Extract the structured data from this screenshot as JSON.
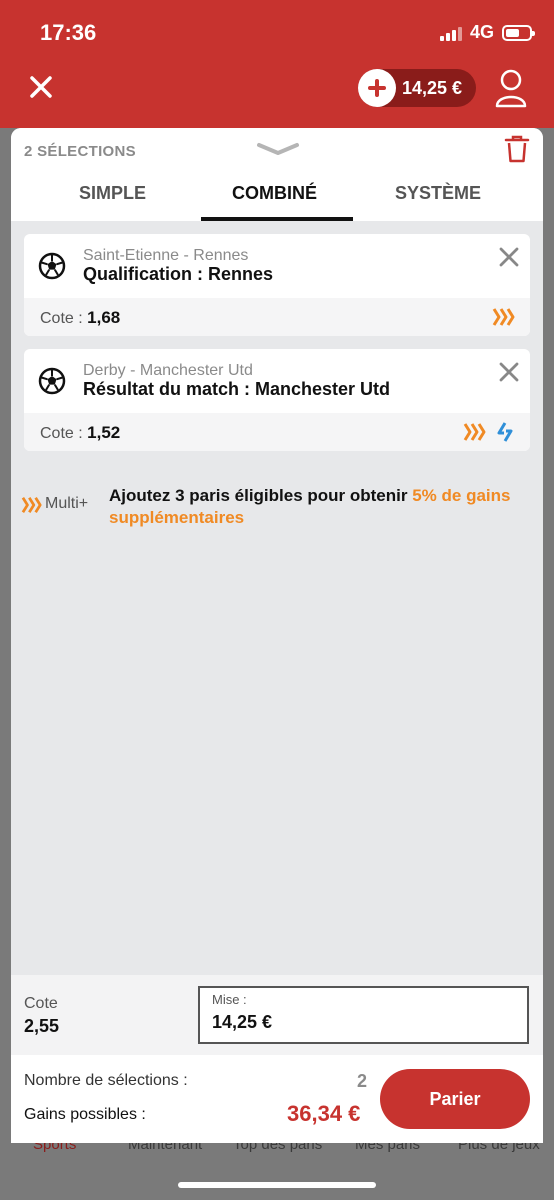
{
  "status_bar": {
    "time": "17:36",
    "network": "4G"
  },
  "header": {
    "close_icon": "close-icon",
    "balance": "14,25 €",
    "add_funds_icon": "plus-icon",
    "user_icon": "user-icon",
    "brand_color": "#c7332f"
  },
  "betslip": {
    "selection_count": "2 SÉLECTIONS",
    "tabs": [
      {
        "label": "SIMPLE",
        "active": false
      },
      {
        "label": "COMBINÉ",
        "active": true
      },
      {
        "label": "SYSTÈME",
        "active": false
      }
    ],
    "bets": [
      {
        "match": "Saint-Etienne - Rennes",
        "selection": "Qualification : Rennes",
        "odds_label": "Cote :",
        "odds": "1,68",
        "badges": [
          "multi-boost-icon"
        ]
      },
      {
        "match": "Derby - Manchester Utd",
        "selection": "Résultat du match : Manchester Utd",
        "odds_label": "Cote :",
        "odds": "1,52",
        "badges": [
          "multi-boost-icon",
          "odds-change-icon"
        ]
      }
    ],
    "promo": {
      "tag": "Multi+",
      "text": "Ajoutez 3 paris éligibles pour obtenir ",
      "highlight": "5% de gains supplémentaires",
      "highlight_color": "#f08a24"
    },
    "stake": {
      "cote_label": "Cote",
      "cote_value": "2,55",
      "mise_label": "Mise :",
      "mise_value": "14,25 €"
    },
    "summary": {
      "nb_label": "Nombre de sélections :",
      "nb_value": "2",
      "gains_label": "Gains possibles :",
      "gains_value": "36,34 €",
      "bet_button": "Parier"
    }
  },
  "bottom_nav": {
    "items": [
      "Sports",
      "Maintenant",
      "Top des paris",
      "Mes paris",
      "Plus de jeux"
    ]
  }
}
